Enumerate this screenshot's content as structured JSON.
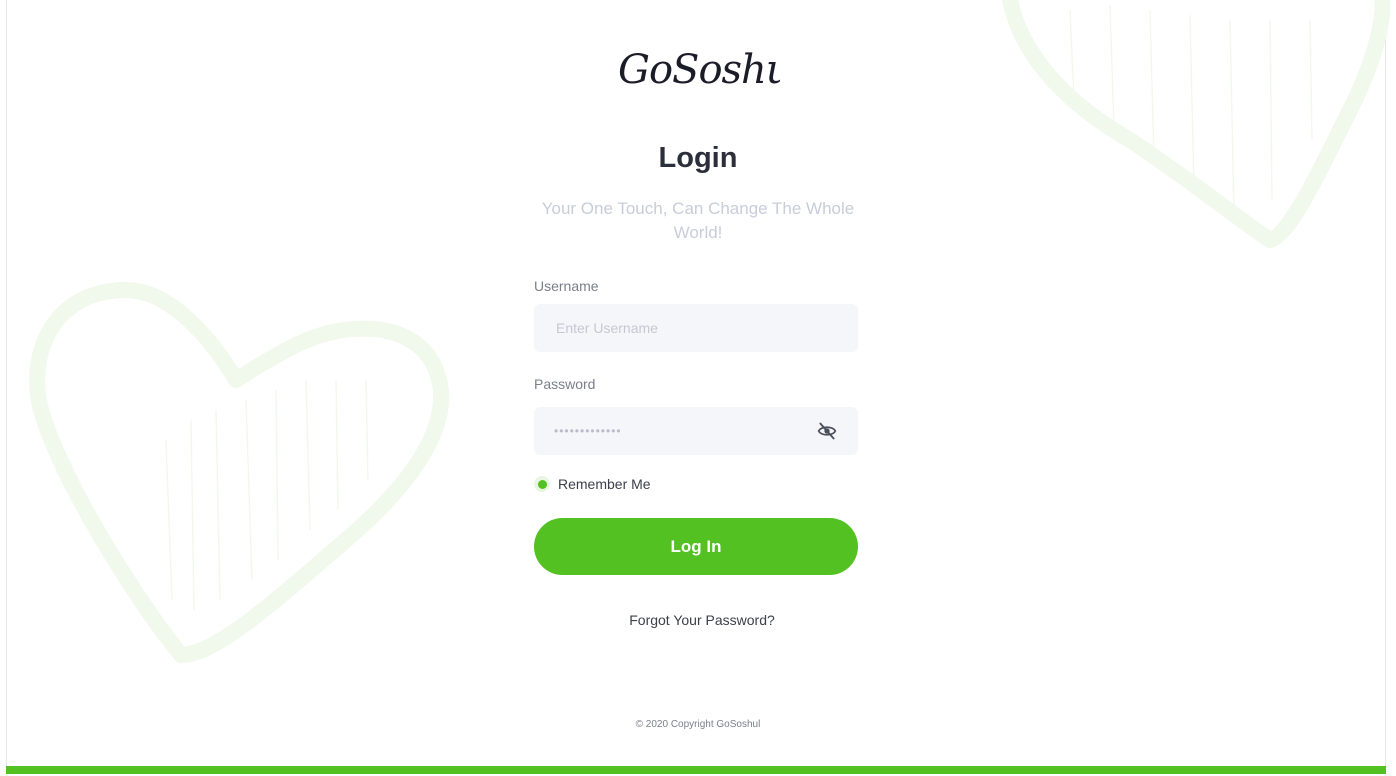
{
  "brand": {
    "logo_text": "GoSoshul",
    "accent_color": "#52c121"
  },
  "login": {
    "title": "Login",
    "subtitle": "Your One Touch, Can Change The Whole World!",
    "username_label": "Username",
    "username_placeholder": "Enter Username",
    "password_label": "Password",
    "password_masked": "•••••••••••••",
    "password_visibility_icon": "eye-slash-icon",
    "remember_label": "Remember Me",
    "remember_checked": true,
    "submit_label": "Log In",
    "forgot_label": "Forgot Your Password?"
  },
  "footer": {
    "copyright": "© 2020 Copyright GoSoshul"
  }
}
